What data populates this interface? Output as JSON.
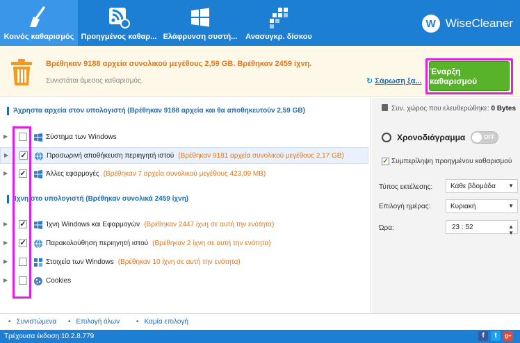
{
  "nav": {
    "tabs": [
      {
        "label": "Κοινός καθαρισμός",
        "icon": "broom-icon"
      },
      {
        "label": "Προηγμένος καθαρ...",
        "icon": "rss-cleaner-icon"
      },
      {
        "label": "Ελάφρυνση συστή...",
        "icon": "windows-icon"
      },
      {
        "label": "Ανασυγκρ. δίσκου",
        "icon": "defrag-icon"
      }
    ],
    "brand": "WiseCleaner",
    "brand_logo_letter": "W"
  },
  "summary": {
    "title": "Βρέθηκαν 9188 αρχεία συνολικού μεγέθους 2,59 GB. Βρέθηκαν 2459 ίχνη.",
    "subtitle": "Συνιστάται άμεσος καθαρισμός.",
    "scan_link": "Σάρωση ξα...",
    "start_button": "Έναρξη καθαρισμού"
  },
  "sections": {
    "junk_title": "Άχρηστα αρχεία στον υπολογιστή (Βρέθηκαν 9188 αρχεία και θα αποθηκευτούν 2,59 GB)",
    "traces_title": "Ίχνη στο υπολογιστή (Βρέθηκαν συνολικά 2459 ίχνη)"
  },
  "junk_items": [
    {
      "name": "Σύστημα των Windows",
      "info": "",
      "checked": false,
      "icon": "windows-icon"
    },
    {
      "name": "Προσωρινή αποθήκευση περιηγητή ιστού",
      "info": "(Βρέθηκαν 9181 αρχεία συνολικού μεγέθους 2,17 GB)",
      "checked": true,
      "icon": "browser-icon"
    },
    {
      "name": "Άλλες εφαρμογές",
      "info": "(Βρέθηκαν 7 αρχεία συνολικού μεγέθους 423,09 MB)",
      "checked": true,
      "icon": "apps-icon"
    }
  ],
  "trace_items": [
    {
      "name": "Ίχνη Windows και Εφαρμογών",
      "info": "(Βρέθηκαν 2447 ίχνη σε αυτή την ενότητα)",
      "checked": true,
      "icon": "windows-icon"
    },
    {
      "name": "Παρακολούθηση περιηγητή ιστού",
      "info": "(Βρέθηκαν 2 ίχνη σε αυτή την ενότητα)",
      "checked": true,
      "icon": "browser-icon"
    },
    {
      "name": "Στοιχεία των Windows",
      "info": "(Βρέθηκαν 10 ίχνη σε αυτή την ενότητα)",
      "checked": false,
      "icon": "windows-components-icon"
    },
    {
      "name": "Cookies",
      "info": "",
      "checked": false,
      "icon": "cookie-icon"
    }
  ],
  "check_mark": "✓",
  "right_panel": {
    "freed_label": "Συν. χώρος που ελευθερώθηκε:",
    "freed_value": "0 Bytes",
    "schedule_title": "Χρονοδιάγραμμα",
    "toggle_state": "OFF",
    "include_advanced": "Συμπερίληψη προηγμένου καθαρισμού",
    "run_type_label": "Τύπος εκτέλεσης:",
    "run_type_value": "Κάθε βδομάδα",
    "day_label": "Επιλογή ημέρας:",
    "day_value": "Κυριακή",
    "time_label": "Ώρα:",
    "time_value": "23 : 52"
  },
  "footer": {
    "recommended": "Συνιστώμενα",
    "select_all": "Επιλογή όλων",
    "select_none": "Καμία επιλογή"
  },
  "status": {
    "version": "Τρέχουσα έκδοση:10.2.8.779",
    "social": [
      "f",
      "t",
      "g+"
    ]
  },
  "colors": {
    "nav_bg": "#1d7fd4",
    "accent_orange": "#e2761b",
    "start_green": "#58b32a",
    "highlight_magenta": "#e11ee6"
  }
}
